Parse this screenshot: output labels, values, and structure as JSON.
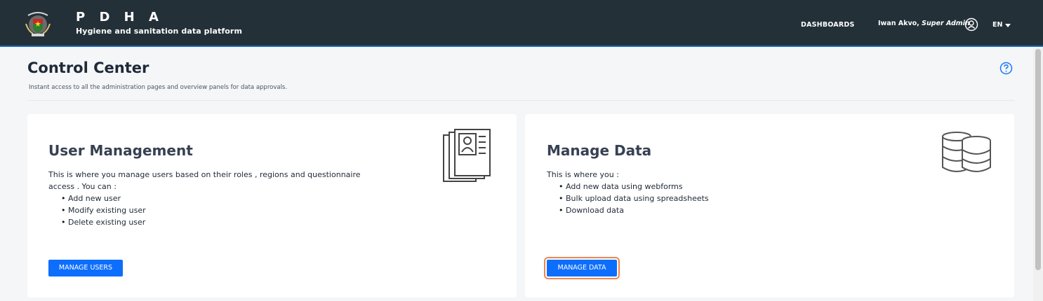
{
  "header": {
    "title": "P D H A",
    "subtitle": "Hygiene and sanitation data platform",
    "logo_icon": "coat-of-arms-logo",
    "nav": {
      "dashboards_label": "DASHBOARDS",
      "user_name": "Iwan Akvo,",
      "user_role": "Super Admin",
      "user_icon": "user-circle-icon",
      "language": "EN",
      "language_icon": "caret-down-icon"
    },
    "colors": {
      "background": "#233038",
      "accent": "#1b6ab5"
    }
  },
  "page": {
    "title": "Control Center",
    "description": "Instant access to all the administration pages and overview panels for data approvals.",
    "help_icon": "help-circle-icon"
  },
  "cards": {
    "users": {
      "title": "User Management",
      "description": "This is where you manage users based on their roles , regions and questionnaire access . You can :",
      "items": [
        "Add new user",
        "Modify existing user",
        "Delete existing user"
      ],
      "button_label": "MANAGE USERS",
      "icon": "user-documents-icon"
    },
    "data": {
      "title": "Manage Data",
      "description": "This is where you :",
      "items": [
        "Add new data using webforms",
        "Bulk upload data using spreadsheets",
        "Download data"
      ],
      "button_label": "MANAGE DATA",
      "icon": "database-icon",
      "focused": true
    }
  },
  "colors": {
    "primary_button": "#0d6efd",
    "focus_ring": "#f0834e",
    "page_background": "#f4f6f8"
  }
}
